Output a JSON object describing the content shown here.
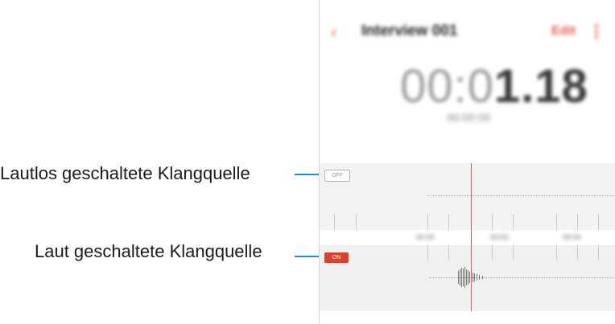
{
  "annotations": {
    "muted_label": "Lautlos geschaltete Klangquelle",
    "loud_label": "Laut geschaltete Klangquelle"
  },
  "app_bar": {
    "back_icon": "chevron-left-icon",
    "title": "Interview 001",
    "edit_label": "Edit",
    "more_icon": "more-vertical-icon"
  },
  "recording": {
    "elapsed_dim": "00:0",
    "elapsed_bold": "1.18",
    "date": "00:00:00"
  },
  "tracks": {
    "muted_badge": "OFF",
    "loud_badge": "ON"
  },
  "timeline": {
    "labels": [
      "00:00",
      "00:02",
      "00:04"
    ]
  },
  "colors": {
    "accent": "#e35b47",
    "callout_line": "#1a8fd0",
    "active_badge": "#d9412f"
  }
}
